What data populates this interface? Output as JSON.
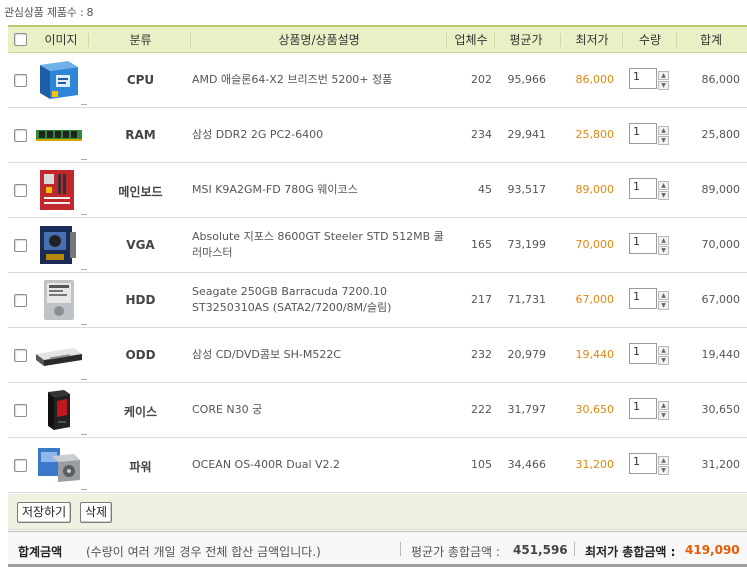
{
  "interest": {
    "label": "관심상품 제품수 :",
    "count": "8"
  },
  "header": {
    "image": "이미지",
    "category": "분류",
    "name": "상품명/상품설명",
    "sellers": "업체수",
    "avg": "평균가",
    "lowest": "최저가",
    "qty": "수량",
    "total": "합계"
  },
  "colors": {
    "lowest_price": "#e0870c",
    "summary_lowest": "#e65c00",
    "header_bg": "#e9f0c6"
  },
  "rows": [
    {
      "category": "CPU",
      "desc": "AMD 애슬론64-X2 브리즈번 5200+ 정품",
      "sellers": "202",
      "avg": "95,966",
      "lowest": "86,000",
      "qty": "1",
      "total": "86,000",
      "icon": "cpu-box-icon"
    },
    {
      "category": "RAM",
      "desc": "삼성 DDR2 2G PC2-6400",
      "sellers": "234",
      "avg": "29,941",
      "lowest": "25,800",
      "qty": "1",
      "total": "25,800",
      "icon": "ram-stick-icon"
    },
    {
      "category": "메인보드",
      "desc": "MSI K9A2GM-FD 780G 웨이코스",
      "sellers": "45",
      "avg": "93,517",
      "lowest": "89,000",
      "qty": "1",
      "total": "89,000",
      "icon": "motherboard-icon"
    },
    {
      "category": "VGA",
      "desc": "Absolute 지포스 8600GT Steeler STD 512MB 쿨러마스터",
      "sellers": "165",
      "avg": "73,199",
      "lowest": "70,000",
      "qty": "1",
      "total": "70,000",
      "icon": "graphics-card-icon"
    },
    {
      "category": "HDD",
      "desc": "Seagate 250GB Barracuda 7200.10 ST3250310AS (SATA2/7200/8M/슬림)",
      "sellers": "217",
      "avg": "71,731",
      "lowest": "67,000",
      "qty": "1",
      "total": "67,000",
      "icon": "hard-disk-icon"
    },
    {
      "category": "ODD",
      "desc": "삼성 CD/DVD콤보 SH-M522C",
      "sellers": "232",
      "avg": "20,979",
      "lowest": "19,440",
      "qty": "1",
      "total": "19,440",
      "icon": "optical-drive-icon"
    },
    {
      "category": "케이스",
      "desc": "CORE N30 궁",
      "sellers": "222",
      "avg": "31,797",
      "lowest": "30,650",
      "qty": "1",
      "total": "30,650",
      "icon": "pc-case-icon"
    },
    {
      "category": "파워",
      "desc": "OCEAN OS-400R Dual V2.2",
      "sellers": "105",
      "avg": "34,466",
      "lowest": "31,200",
      "qty": "1",
      "total": "31,200",
      "icon": "power-supply-icon"
    }
  ],
  "buttons": {
    "save": "저장하기",
    "delete": "삭제"
  },
  "summary": {
    "title": "합계금액",
    "note": "(수량이 여러 개일 경우 전체 합산 금액입니다.)",
    "avg_label": "평균가 총합금액 :",
    "avg_value": "451,596",
    "low_label": "최저가 총합금액 :",
    "low_value": "419,090"
  }
}
